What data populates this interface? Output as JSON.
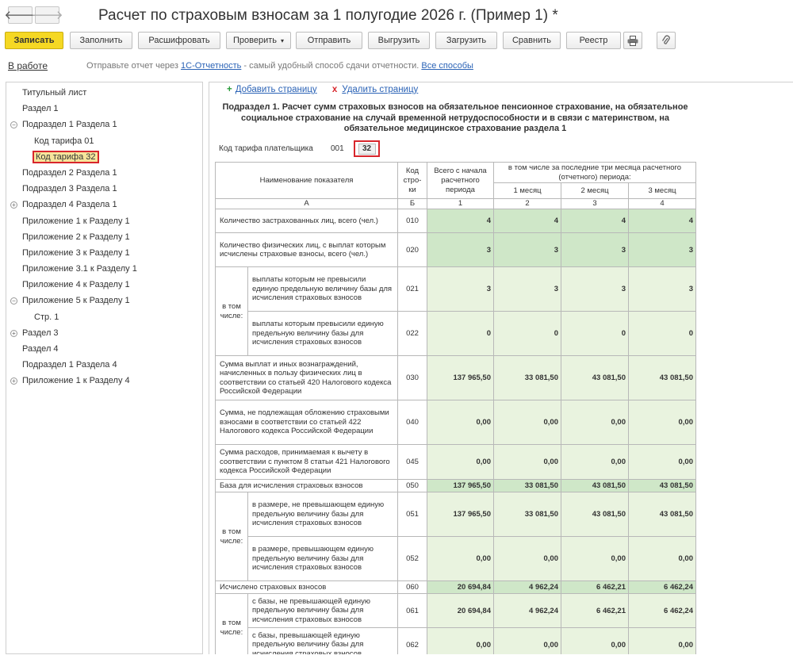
{
  "window": {
    "title": "Расчет по страховым взносам за 1 полугодие 2026 г. (Пример 1) *"
  },
  "nav": {
    "back_glyph": "🡐",
    "forward_glyph": "🡒"
  },
  "toolbar": {
    "save": "Записать",
    "fill": "Заполнить",
    "decode": "Расшифровать",
    "check": "Проверить",
    "send": "Отправить",
    "export": "Выгрузить",
    "import": "Загрузить",
    "compare": "Сравнить",
    "registry": "Реестр",
    "print_icon": "printer-icon",
    "attach_icon": "paperclip-icon"
  },
  "infobar": {
    "status": "В работе",
    "msg_before": "Отправьте отчет через ",
    "link1": "1С-Отчетность",
    "msg_after": " - самый удобный способ сдачи отчетности. ",
    "link2": "Все способы"
  },
  "tree": [
    {
      "label": "Титульный лист",
      "level": 0,
      "exp": ""
    },
    {
      "label": "Раздел 1",
      "level": 0,
      "exp": ""
    },
    {
      "label": "Подраздел 1 Раздела 1",
      "level": 0,
      "exp": "−"
    },
    {
      "label": "Код тарифа 01",
      "level": 1,
      "exp": ""
    },
    {
      "label": "Код тарифа 32",
      "level": 1,
      "exp": "",
      "selected": true
    },
    {
      "label": "Подраздел 2 Раздела 1",
      "level": 0,
      "exp": ""
    },
    {
      "label": "Подраздел 3 Раздела 1",
      "level": 0,
      "exp": ""
    },
    {
      "label": "Подраздел 4 Раздела 1",
      "level": 0,
      "exp": "+"
    },
    {
      "label": "Приложение 1 к Разделу 1",
      "level": 0,
      "exp": ""
    },
    {
      "label": "Приложение 2 к Разделу 1",
      "level": 0,
      "exp": ""
    },
    {
      "label": "Приложение 3 к Разделу 1",
      "level": 0,
      "exp": ""
    },
    {
      "label": "Приложение 3.1 к Разделу 1",
      "level": 0,
      "exp": ""
    },
    {
      "label": "Приложение 4 к Разделу 1",
      "level": 0,
      "exp": ""
    },
    {
      "label": "Приложение 5 к Разделу 1",
      "level": 0,
      "exp": "−"
    },
    {
      "label": "Стр. 1",
      "level": 1,
      "exp": ""
    },
    {
      "label": "Раздел 3",
      "level": 0,
      "exp": "+"
    },
    {
      "label": "Раздел 4",
      "level": 0,
      "exp": ""
    },
    {
      "label": "Подраздел 1 Раздела 4",
      "level": 0,
      "exp": ""
    },
    {
      "label": "Приложение 1 к Разделу 4",
      "level": 0,
      "exp": "+"
    }
  ],
  "actions": {
    "add": "Добавить страницу",
    "add_glyph": "+",
    "delete": "Удалить страницу",
    "delete_glyph": "x"
  },
  "form": {
    "heading": "Подраздел 1. Расчет сумм страховых взносов на обязательное пенсионное страхование, на обязательное социальное страхование на случай временной нетрудоспособности и в связи с материнством, на обязательное медицинское страхование раздела 1",
    "tariff_label": "Код тарифа плательщика",
    "tariff_code": "001",
    "tariff_value": "32",
    "header": {
      "name": "Наименование показателя",
      "code": "Код стро-ки",
      "total": "Всего с начала расчетного периода",
      "last3": "в том числе за последние три месяца расчетного (отчетного) периода:",
      "m1": "1 месяц",
      "m2": "2 месяц",
      "m3": "3 месяц",
      "colA": "А",
      "colB": "Б",
      "col1": "1",
      "col2": "2",
      "col3": "3",
      "col4": "4"
    },
    "incl": "в том числе:",
    "rows": {
      "r010": {
        "label": "Количество застрахованных лиц, всего (чел.)",
        "code": "010",
        "v": [
          "4",
          "4",
          "4",
          "4"
        ]
      },
      "r020": {
        "label": "Количество физических лиц, с выплат которым исчислены страховые взносы, всего (чел.)",
        "code": "020",
        "v": [
          "3",
          "3",
          "3",
          "3"
        ]
      },
      "r021": {
        "label": "выплаты которым не превысили единую предельную величину базы для исчисления страховых взносов",
        "code": "021",
        "v": [
          "3",
          "3",
          "3",
          "3"
        ]
      },
      "r022": {
        "label": "выплаты которым превысили единую предельную величину базы для исчисления страховых взносов",
        "code": "022",
        "v": [
          "0",
          "0",
          "0",
          "0"
        ]
      },
      "r030": {
        "label": "Сумма выплат и иных вознаграждений, начисленных в пользу физических лиц в соответствии со статьей 420 Налогового кодекса Российской Федерации",
        "code": "030",
        "v": [
          "137 965,50",
          "33 081,50",
          "43 081,50",
          "43 081,50"
        ]
      },
      "r040": {
        "label": "Сумма, не подлежащая обложению страховыми взносами в соответствии со статьей 422 Налогового кодекса Российской Федерации",
        "code": "040",
        "v": [
          "0,00",
          "0,00",
          "0,00",
          "0,00"
        ]
      },
      "r045": {
        "label": "Сумма расходов, принимаемая к вычету в соответствии с пунктом 8 статьи 421 Налогового кодекса Российской Федерации",
        "code": "045",
        "v": [
          "0,00",
          "0,00",
          "0,00",
          "0,00"
        ]
      },
      "r050": {
        "label": "База для исчисления страховых взносов",
        "code": "050",
        "v": [
          "137 965,50",
          "33 081,50",
          "43 081,50",
          "43 081,50"
        ]
      },
      "r051": {
        "label": "в размере, не превышающем единую предельную величину базы для исчисления страховых взносов",
        "code": "051",
        "v": [
          "137 965,50",
          "33 081,50",
          "43 081,50",
          "43 081,50"
        ]
      },
      "r052": {
        "label": "в размере, превышающем единую предельную величину базы для исчисления страховых взносов",
        "code": "052",
        "v": [
          "0,00",
          "0,00",
          "0,00",
          "0,00"
        ]
      },
      "r060": {
        "label": "Исчислено страховых взносов",
        "code": "060",
        "v": [
          "20 694,84",
          "4 962,24",
          "6 462,21",
          "6 462,24"
        ]
      },
      "r061": {
        "label": "с базы, не превышающей единую предельную величину базы для исчисления страховых взносов",
        "code": "061",
        "v": [
          "20 694,84",
          "4 962,24",
          "6 462,21",
          "6 462,24"
        ]
      },
      "r062": {
        "label": "с базы, превышающей единую предельную величину базы для исчисления страховых взносов",
        "code": "062",
        "v": [
          "0,00",
          "0,00",
          "0,00",
          "0,00"
        ]
      }
    }
  },
  "colors": {
    "accent": "#f5d823",
    "highlight": "#d8262c",
    "link": "#2b63b6",
    "cell_light": "#e9f3df",
    "cell_dark": "#cfe7c8"
  }
}
